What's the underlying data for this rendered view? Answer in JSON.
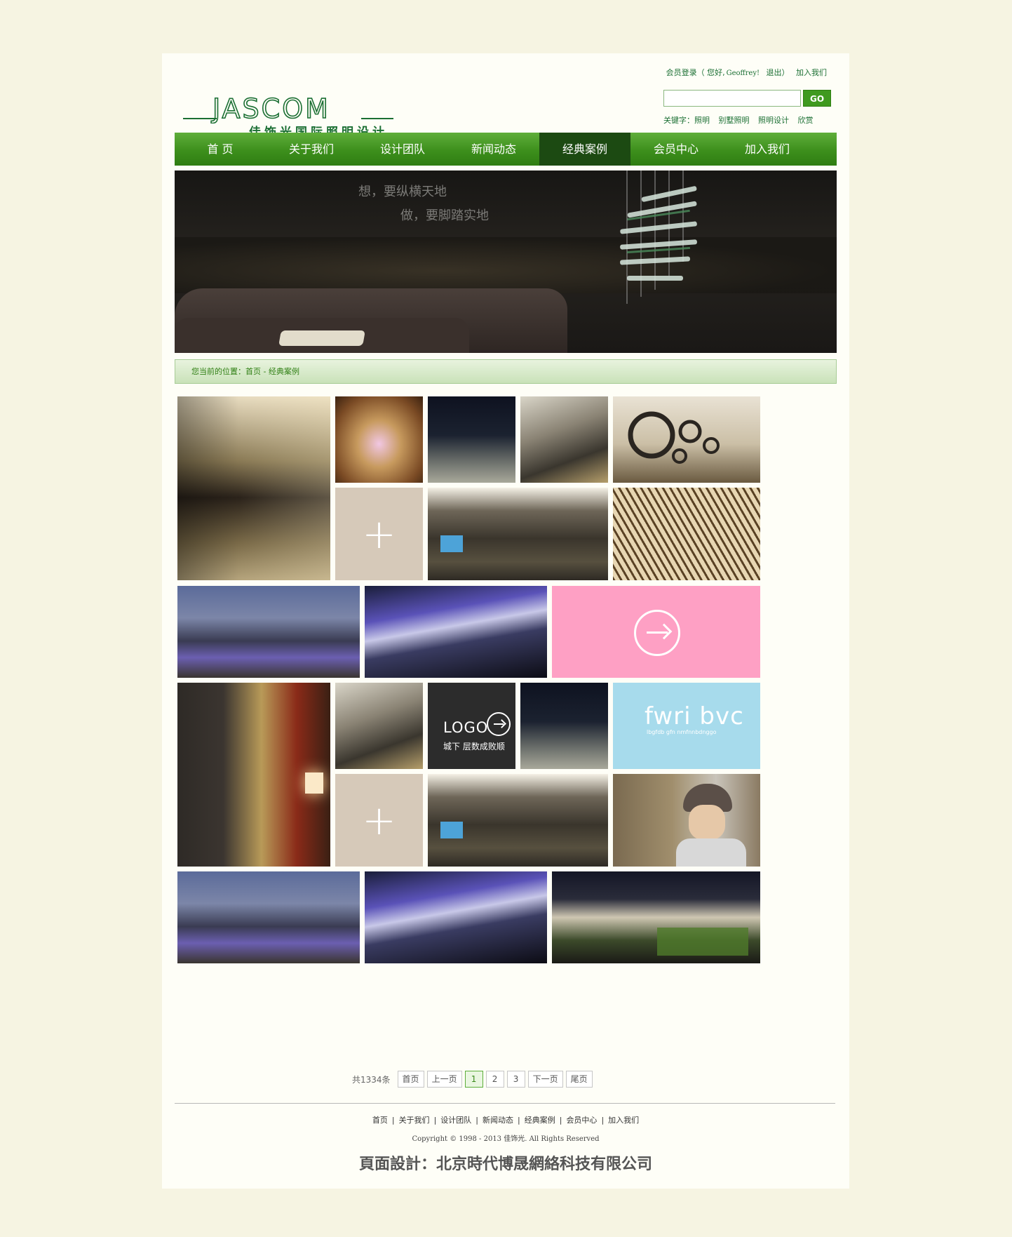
{
  "header": {
    "logo_text": "JASCOM",
    "logo_sub": "佳饰光国际照明设计",
    "member_login": "会员登录（ 您好,",
    "user": "Geoffrey!",
    "logout": "退出",
    "close_paren": "）",
    "join": "加入我们",
    "search_placeholder": "",
    "search_button": "GO",
    "keywords_label": "关键字：",
    "keywords": [
      "照明",
      "别墅照明",
      "照明设计",
      "欣赏"
    ]
  },
  "nav": {
    "items": [
      "首 页",
      "关于我们",
      "设计团队",
      "新闻动态",
      "经典案例",
      "会员中心",
      "加入我们"
    ],
    "active_index": 4
  },
  "banner": {
    "line1": "想，要纵横天地",
    "line2": "做，要脚踏实地"
  },
  "breadcrumb": "您当前的位置：首页 - 经典案例",
  "tiles": {
    "logo_tile_text": "LOGO",
    "logo_tile_sub": "城下 层数成败顺",
    "fwri_text": "fwri bvc",
    "fwri_sub": "lbgfdb gfn nmfnnbdnggo",
    "plus": "+",
    "colors": {
      "beige": "#d6c9b9",
      "pink": "#fea0c4",
      "light_blue": "#a7dbec",
      "dark": "#2c2c2c"
    }
  },
  "pager": {
    "total": "共1334条",
    "first": "首页",
    "prev": "上一页",
    "pages": [
      "1",
      "2",
      "3"
    ],
    "current": "1",
    "next": "下一页",
    "last": "尾页"
  },
  "footer": {
    "links": [
      "首页",
      "关于我们",
      "设计团队",
      "新闻动态",
      "经典案例",
      "会员中心",
      "加入我们"
    ],
    "separator": "|",
    "copyright": "Copyright © 1998 - 2013 佳饰光. All Rights Reserved",
    "design_credit": "頁面設計：北京時代博晟網絡科技有限公司"
  },
  "colors": {
    "brand_green": "#1b6f33",
    "nav_green": "#3d8f1c",
    "page_bg": "#f6f4e2"
  }
}
